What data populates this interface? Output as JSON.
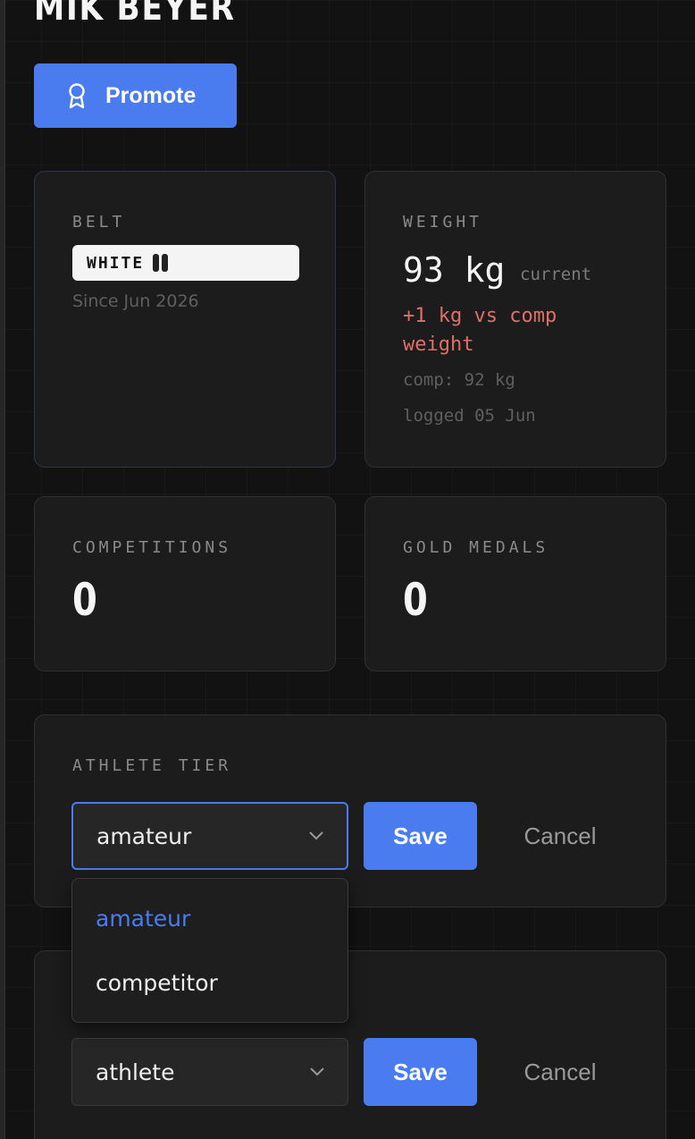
{
  "page": {
    "title": "MIK BEYER"
  },
  "actions": {
    "promote_label": "Promote",
    "promote_icon": "award-ribbon-icon"
  },
  "belt": {
    "label": "BELT",
    "value": "WHITE",
    "stripes": 2,
    "since": "Since Jun 2026"
  },
  "weight": {
    "label": "WEIGHT",
    "value": "93 kg",
    "qualifier": "current",
    "diff": "+1 kg vs comp weight",
    "comp": "comp: 92 kg",
    "logged": "logged 05 Jun"
  },
  "stats": {
    "competitions": {
      "label": "COMPETITIONS",
      "value": "0"
    },
    "gold_medals": {
      "label": "GOLD MEDALS",
      "value": "0"
    }
  },
  "athlete_tier": {
    "label": "ATHLETE TIER",
    "selected": "amateur",
    "options": [
      "amateur",
      "competitor"
    ],
    "save_label": "Save",
    "cancel_label": "Cancel"
  },
  "role": {
    "selected": "athlete",
    "save_label": "Save",
    "cancel_label": "Cancel"
  },
  "colors": {
    "accent": "#4a7cf0",
    "warning": "#e06f66",
    "background": "#121212",
    "card": "#1c1c1c"
  }
}
